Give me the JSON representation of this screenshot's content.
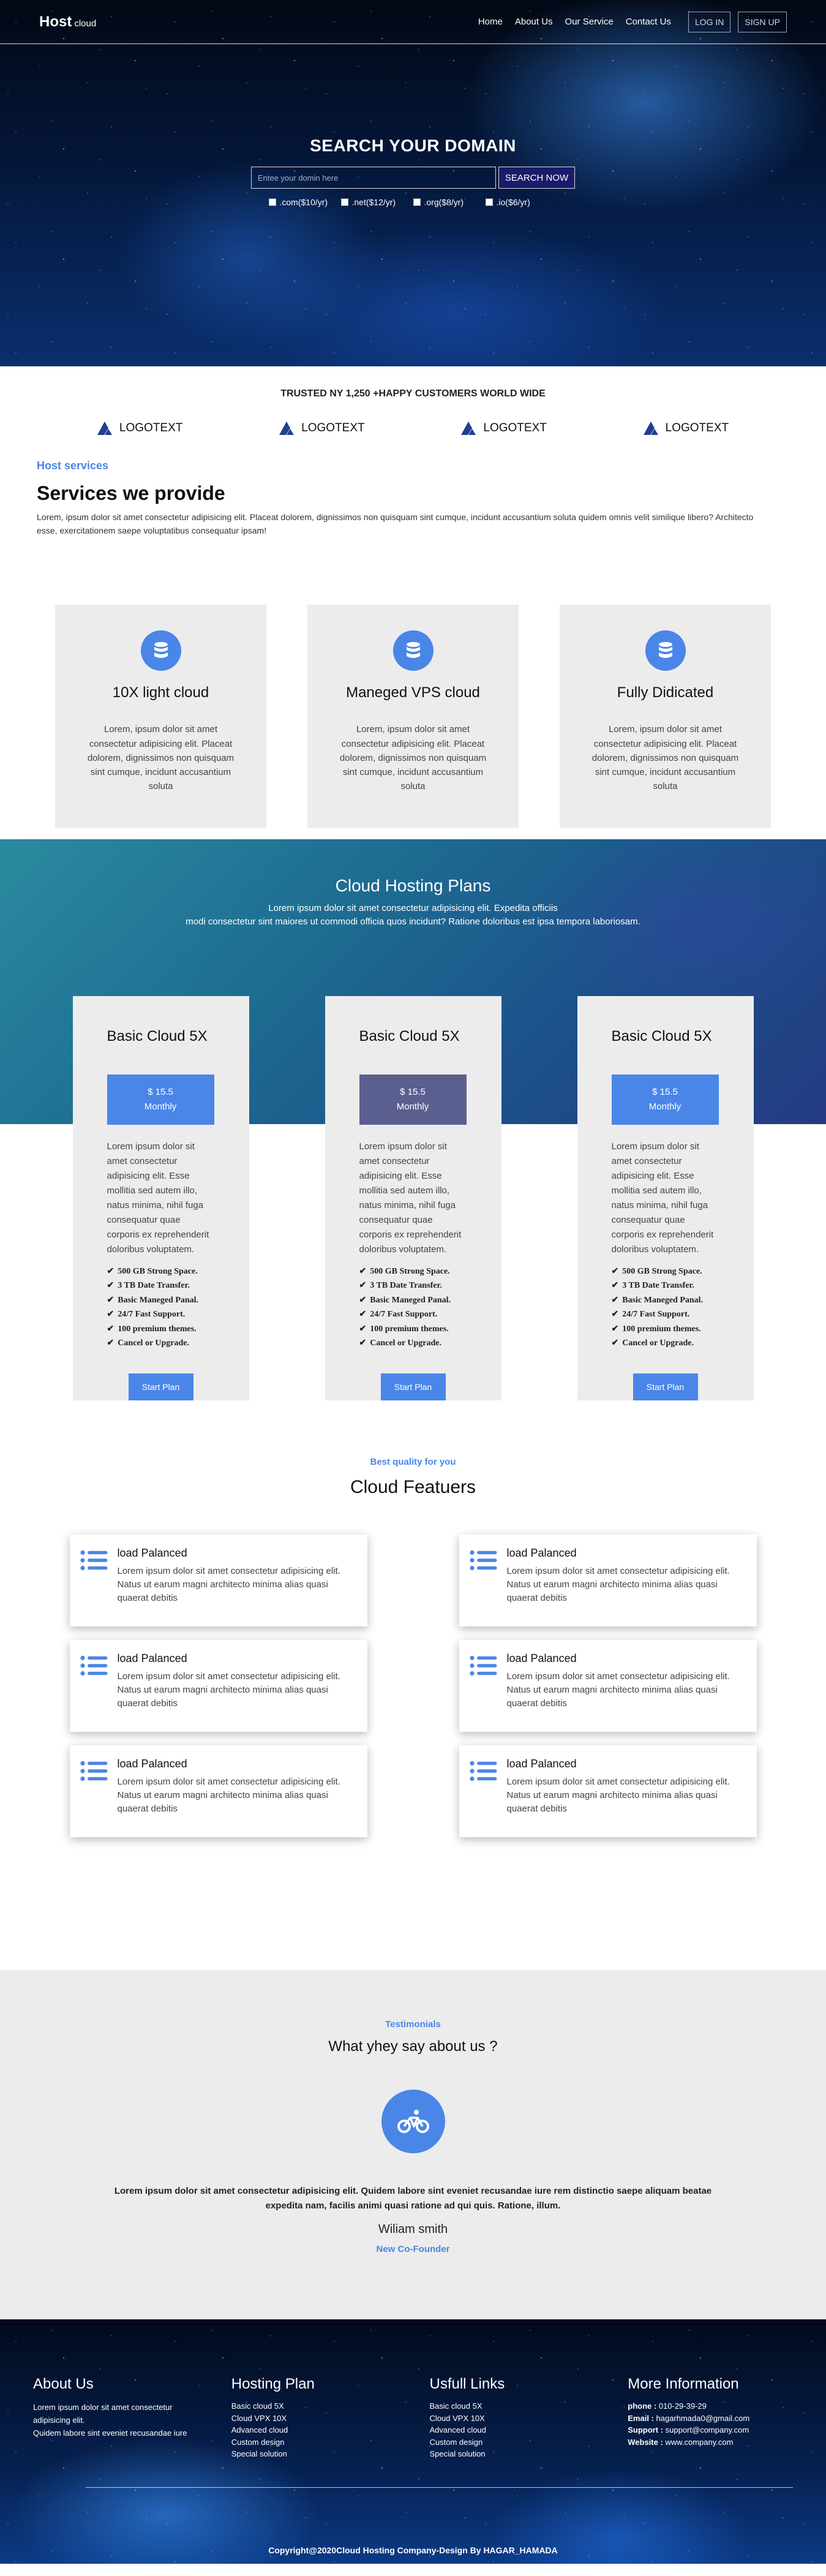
{
  "nav": {
    "logo_main": "Host",
    "logo_sub": "cloud",
    "links": [
      "Home",
      "About Us",
      "Our Service",
      "Contact Us"
    ],
    "login": "LOG IN",
    "signup": "SIGN UP"
  },
  "hero": {
    "title": "SEARCH YOUR DOMAIN",
    "search_placeholder": "Entee your domin here",
    "search_button": "SEARCH NOW",
    "tlds": [
      ".com($10/yr)",
      ".net($12/yr)",
      ".org($8/yr)",
      ".io($6/yr)"
    ]
  },
  "trusted": {
    "title": "TRUSTED NY 1,250 +HAPPY CUSTOMERS WORLD WIDE",
    "logos": [
      "LOGOTEXT",
      "LOGOTEXT",
      "LOGOTEXT",
      "LOGOTEXT"
    ]
  },
  "services": {
    "eyebrow": "Host services",
    "title": "Services we provide",
    "description": "Lorem, ipsum dolor sit amet consectetur adipisicing elit. Placeat dolorem, dignissimos non quisquam sint cumque, incidunt accusantium soluta quidem omnis velit similique libero? Architecto esse, exercitationem saepe voluptatibus consequatur ipsam!",
    "cards": [
      {
        "icon": "database-icon",
        "title": "10X light cloud",
        "text": "Lorem, ipsum dolor sit amet consectetur adipisicing elit. Placeat dolorem, dignissimos non quisquam sint cumque, incidunt accusantium soluta"
      },
      {
        "icon": "database-icon",
        "title": "Maneged VPS cloud",
        "text": "Lorem, ipsum dolor sit amet consectetur adipisicing elit. Placeat dolorem, dignissimos non quisquam sint cumque, incidunt accusantium soluta"
      },
      {
        "icon": "database-icon",
        "title": "Fully Didicated",
        "text": "Lorem, ipsum dolor sit amet consectetur adipisicing elit. Placeat dolorem, dignissimos non quisquam sint cumque, incidunt accusantium soluta"
      }
    ]
  },
  "plans": {
    "title": "Cloud Hosting Plans",
    "subtitle_1": "Lorem ipsum dolor sit amet consectetur adipisicing elit. Expedita officiis",
    "subtitle_2": "modi consectetur sint maiores ut commodi officia quos incidunt? Ratione doloribus est ipsa tempora laboriosam.",
    "cards": [
      {
        "name": "Basic Cloud 5X",
        "price": "$ 15.5",
        "period": "Monthly",
        "button": "Start Plan"
      },
      {
        "name": "Basic Cloud 5X",
        "price": "$ 15.5",
        "period": "Monthly",
        "button": "Start Plan"
      },
      {
        "name": "Basic Cloud 5X",
        "price": "$ 15.5",
        "period": "Monthly",
        "button": "Start Plan"
      }
    ],
    "description": "Lorem ipsum dolor sit amet consectetur adipisicing elit. Esse mollitia sed autem illo, natus minima, nihil fuga consequatur quae corporis ex reprehenderit doloribus voluptatem.",
    "features": [
      "500 GB Strong Space.",
      "3 TB Date Transfer.",
      "Basic Maneged Panal.",
      "24/7 Fast Support.",
      "100 premium themes.",
      "Cancel or Upgrade."
    ]
  },
  "cloud_features": {
    "eyebrow": "Best quality for you",
    "title": "Cloud Featuers",
    "card_title": "load Palanced",
    "card_text": "Lorem ipsum dolor sit amet consectetur adipisicing elit. Natus ut earum magni architecto minima alias quasi quaerat debitis"
  },
  "testimonials": {
    "eyebrow": "Testimonials",
    "title": "What yhey say about us ?",
    "quote": "Lorem ipsum dolor sit amet consectetur adipisicing elit. Quidem labore sint eveniet recusandae iure rem distinctio saepe aliquam beatae expedita nam, facilis animi quasi ratione ad qui quis. Ratione, illum.",
    "name": "Wiliam smith",
    "role": "New Co-Founder"
  },
  "footer": {
    "about_title": "About Us",
    "about_text_1": "Lorem ipsum dolor sit amet consectetur adipisicing elit.",
    "about_text_2": "Quidem labore sint eveniet recusandae iure",
    "hosting_title": "Hosting Plan",
    "hosting_items": [
      "Basic cloud 5X",
      "Cloud VPX 10X",
      "Advanced cloud",
      "Custom design",
      "Special solution"
    ],
    "links_title": "Usfull Links",
    "links_items": [
      "Basic cloud 5X",
      "Cloud VPX 10X",
      "Advanced cloud",
      "Custom design",
      "Special solution"
    ],
    "info_title": "More Information",
    "phone_label": "phone :",
    "phone": "010-29-39-29",
    "email_label": "Email :",
    "email": "hagarhmada0@gmail.com",
    "support_label": "Support :",
    "support": "support@company.com",
    "website_label": "Website :",
    "website": "www.company.com",
    "copyright": "Copyright@2020Cloud Hosting Company-Design By HAGAR_HAMADA"
  },
  "colors": {
    "accent": "#4a86e8",
    "card_bg": "#ececec",
    "search_button": "#1a1b6b",
    "alt_price": "#5b5f8f"
  }
}
